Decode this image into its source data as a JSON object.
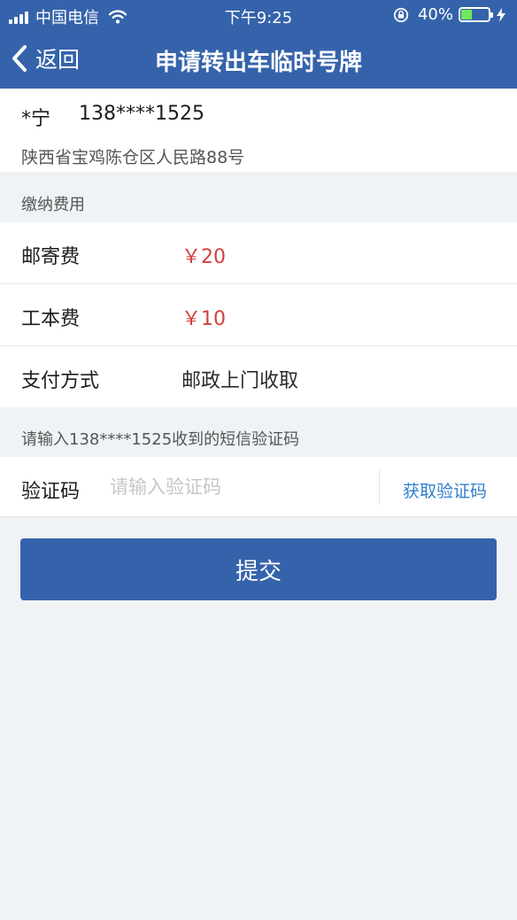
{
  "status_bar": {
    "carrier": "中国电信",
    "time": "下午9:25",
    "battery_percent": "40%",
    "battery_level": 0.4,
    "battery_color": "#6fe85a"
  },
  "nav": {
    "back_label": "返回",
    "title": "申请转出车临时号牌",
    "background_color": "#3563ab"
  },
  "contact": {
    "name": "*宁",
    "phone": "138****1525",
    "address": "陕西省宝鸡陈仓区人民路88号"
  },
  "fees": {
    "section_label": "缴纳费用",
    "items": [
      {
        "label": "邮寄费",
        "value": "￥20"
      },
      {
        "label": "工本费",
        "value": "￥10"
      },
      {
        "label": "支付方式",
        "value": "邮政上门收取"
      }
    ],
    "amount_color": "#d0403d"
  },
  "verification": {
    "hint": "请输入138****1525收到的短信验证码",
    "label": "验证码",
    "placeholder": "请输入验证码",
    "value": "",
    "get_code_label": "获取验证码",
    "link_color": "#2f7fcf"
  },
  "submit": {
    "label": "提交"
  },
  "icons": [
    "signal-icon",
    "wifi-icon",
    "lock-icon",
    "battery-icon",
    "charging-bolt-icon",
    "back-chevron-icon"
  ]
}
